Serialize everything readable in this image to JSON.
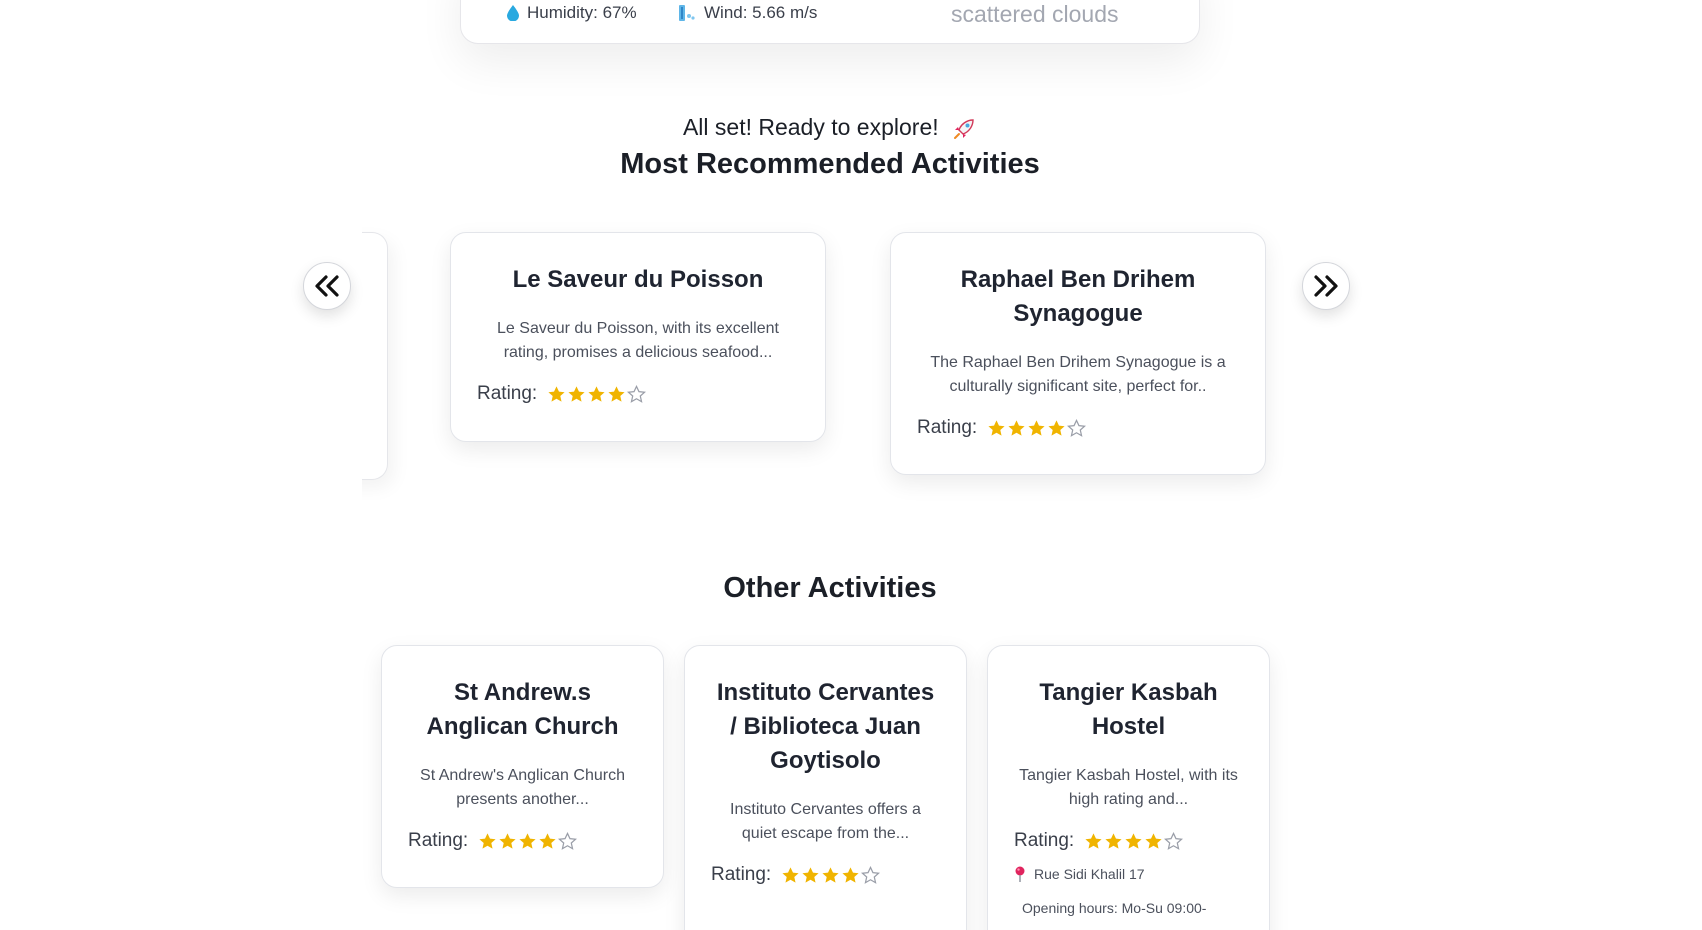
{
  "weather": {
    "humidity": "Humidity: 67%",
    "wind": "Wind: 5.66 m/s",
    "description": "scattered clouds",
    "humidity_icon": "water-drop-icon",
    "wind_icon": "wind-icon"
  },
  "header": {
    "ready": "All set! Ready to explore!",
    "ready_icon": "rocket-icon",
    "recommended_title": "Most Recommended Activities",
    "other_title": "Other Activities"
  },
  "carousel": {
    "prev_icon": "double-chevron-left-icon",
    "next_icon": "double-chevron-right-icon",
    "cards": [
      {
        "title": "Le Saveur du Poisson",
        "description": "Le Saveur du Poisson, with its excellent rating, promises a delicious seafood...",
        "rating_label": "Rating:",
        "rating": 4
      },
      {
        "title": "Raphael Ben Drihem Synagogue",
        "description": "The Raphael Ben Drihem Synagogue is a culturally significant site, perfect for..",
        "rating_label": "Rating:",
        "rating": 4
      }
    ]
  },
  "other": {
    "cards": [
      {
        "title": "St Andrew.s Anglican Church",
        "description": "St Andrew's Anglican Church presents another...",
        "rating_label": "Rating:",
        "rating": 4
      },
      {
        "title": "Instituto Cervantes / Biblioteca Juan Goytisolo",
        "description": "Instituto Cervantes offers a quiet escape from the...",
        "rating_label": "Rating:",
        "rating": 4
      },
      {
        "title": "Tangier Kasbah Hostel",
        "description": "Tangier Kasbah Hostel, with its high rating and...",
        "rating_label": "Rating:",
        "rating": 4,
        "address": "Rue Sidi Khalil 17",
        "hours": "Opening hours: Mo-Su 09:00-"
      }
    ]
  },
  "colors": {
    "star_filled": "#f0b400",
    "star_empty": "#9a9ea8",
    "drop": "#29a9e0",
    "pin": "#e0245e"
  }
}
